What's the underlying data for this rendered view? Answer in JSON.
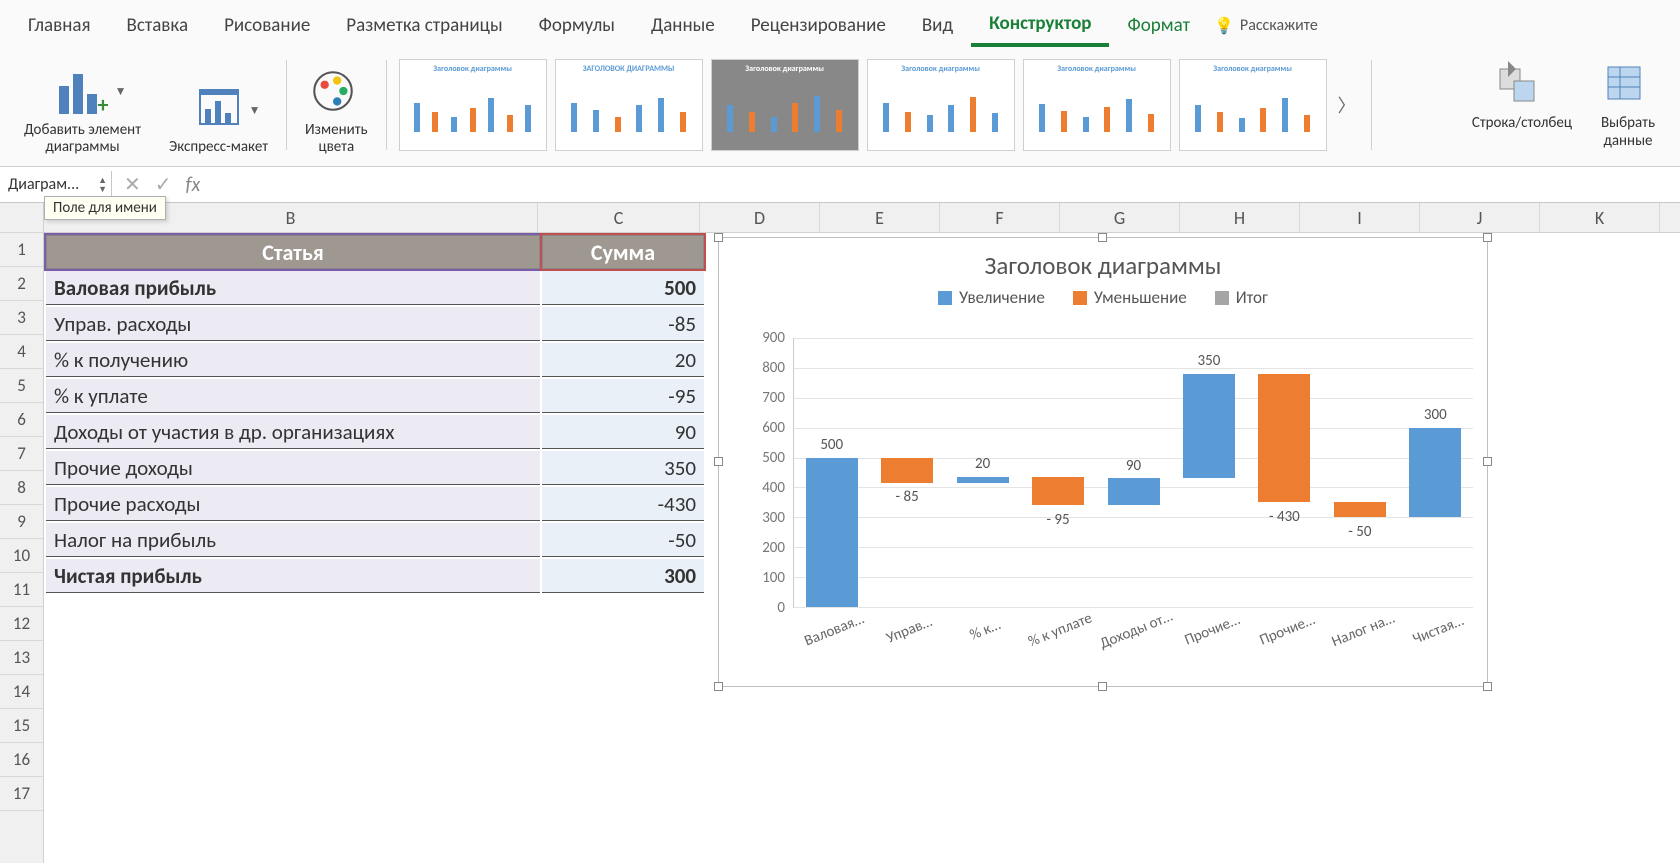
{
  "ribbon": {
    "tabs": [
      "Главная",
      "Вставка",
      "Рисование",
      "Разметка страницы",
      "Формулы",
      "Данные",
      "Рецензирование",
      "Вид",
      "Конструктор",
      "Формат"
    ],
    "active_tab": "Конструктор",
    "tell_me": "Расскажите",
    "groups": {
      "add_element": "Добавить элемент\nдиаграммы",
      "quick_layout": "Экспресс-макет",
      "change_colors": "Изменить\nцвета",
      "switch_rowcol": "Строка/столбец",
      "select_data": "Выбрать\nданные"
    },
    "style_thumb_title": "Заголовок диаграммы",
    "style_thumb_title_upper": "ЗАГОЛОВОК ДИАГРАММЫ"
  },
  "formula_bar": {
    "name_box": "Диаграм...",
    "name_tooltip": "Поле для имени",
    "fx": "fx"
  },
  "columns": [
    "B",
    "C",
    "D",
    "E",
    "F",
    "G",
    "H",
    "I",
    "J",
    "K"
  ],
  "rows": [
    "1",
    "2",
    "3",
    "4",
    "5",
    "6",
    "7",
    "8",
    "9",
    "10",
    "11",
    "12",
    "13",
    "14",
    "15",
    "16",
    "17"
  ],
  "table": {
    "headers": [
      "Статья",
      "Сумма"
    ],
    "rows": [
      {
        "label": "Валовая прибыль",
        "value": "500",
        "bold": true
      },
      {
        "label": "Управ. расходы",
        "value": "-85",
        "bold": false
      },
      {
        "label": "% к получению",
        "value": "20",
        "bold": false
      },
      {
        "label": "% к уплате",
        "value": "-95",
        "bold": false
      },
      {
        "label": "Доходы от участия в др. организациях",
        "value": "90",
        "bold": false
      },
      {
        "label": "Прочие доходы",
        "value": "350",
        "bold": false
      },
      {
        "label": "Прочие расходы",
        "value": "-430",
        "bold": false
      },
      {
        "label": "Налог на прибыль",
        "value": "-50",
        "bold": false
      },
      {
        "label": "Чистая прибыль",
        "value": "300",
        "bold": true
      }
    ]
  },
  "chart": {
    "title": "Заголовок диаграммы",
    "legend": {
      "increase": "Увеличение",
      "decrease": "Уменьшение",
      "total": "Итог"
    },
    "colors": {
      "increase": "#5b9bd5",
      "decrease": "#ed7d31",
      "total": "#a5a5a5"
    },
    "y_ticks": [
      "0",
      "100",
      "200",
      "300",
      "400",
      "500",
      "600",
      "700",
      "800",
      "900"
    ]
  },
  "chart_data": {
    "type": "bar",
    "title": "Заголовок диаграммы",
    "ylim": [
      0,
      900
    ],
    "categories": [
      "Валовая…",
      "Управ…",
      "% к…",
      "% к уплате",
      "Доходы от…",
      "Прочие…",
      "Прочие…",
      "Налог на…",
      "Чистая…"
    ],
    "series": [
      {
        "name": "Увеличение",
        "color": "#5b9bd5"
      },
      {
        "name": "Уменьшение",
        "color": "#ed7d31"
      },
      {
        "name": "Итог",
        "color": "#a5a5a5"
      }
    ],
    "waterfall": [
      {
        "cat": "Валовая…",
        "label": "500",
        "value": 500,
        "base": 0,
        "top": 500,
        "kind": "increase"
      },
      {
        "cat": "Управ…",
        "label": "- 85",
        "value": -85,
        "base": 415,
        "top": 500,
        "kind": "decrease"
      },
      {
        "cat": "% к…",
        "label": "20",
        "value": 20,
        "base": 415,
        "top": 435,
        "kind": "increase"
      },
      {
        "cat": "% к уплате",
        "label": "- 95",
        "value": -95,
        "base": 340,
        "top": 435,
        "kind": "decrease"
      },
      {
        "cat": "Доходы от…",
        "label": "90",
        "value": 90,
        "base": 340,
        "top": 430,
        "kind": "increase"
      },
      {
        "cat": "Прочие…",
        "label": "350",
        "value": 350,
        "base": 430,
        "top": 780,
        "kind": "increase"
      },
      {
        "cat": "Прочие…",
        "label": "- 430",
        "value": -430,
        "base": 350,
        "top": 780,
        "kind": "decrease"
      },
      {
        "cat": "Налог на…",
        "label": "- 50",
        "value": -50,
        "base": 300,
        "top": 350,
        "kind": "decrease"
      },
      {
        "cat": "Чистая…",
        "label": "300",
        "value": 300,
        "base": 0,
        "top": 600,
        "kind": "increase",
        "render_top": 600,
        "render_base": 300
      }
    ]
  }
}
